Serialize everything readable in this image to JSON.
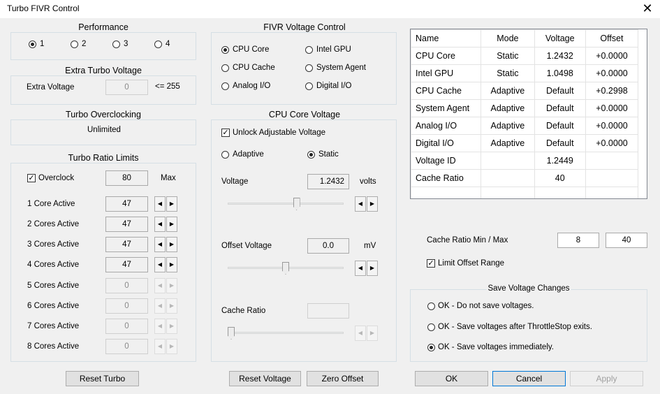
{
  "window": {
    "title": "Turbo FIVR Control",
    "close_glyph": "✕"
  },
  "performance": {
    "title": "Performance",
    "options": [
      {
        "label": "1",
        "selected": true
      },
      {
        "label": "2",
        "selected": false
      },
      {
        "label": "3",
        "selected": false
      },
      {
        "label": "4",
        "selected": false
      }
    ]
  },
  "extra_turbo": {
    "title": "Extra Turbo Voltage",
    "label": "Extra Voltage",
    "value": "0",
    "note": "<= 255"
  },
  "turbo_overclocking": {
    "title": "Turbo Overclocking",
    "status": "Unlimited"
  },
  "turbo_ratio": {
    "title": "Turbo Ratio Limits",
    "overclock_label": "Overclock",
    "overclock_checked": true,
    "overclock_value": "80",
    "max_label": "Max",
    "rows": [
      {
        "label": "1 Core Active",
        "value": "47",
        "enabled": true
      },
      {
        "label": "2 Cores Active",
        "value": "47",
        "enabled": true
      },
      {
        "label": "3 Cores Active",
        "value": "47",
        "enabled": true
      },
      {
        "label": "4 Cores Active",
        "value": "47",
        "enabled": true
      },
      {
        "label": "5 Cores Active",
        "value": "0",
        "enabled": false
      },
      {
        "label": "6 Cores Active",
        "value": "0",
        "enabled": false
      },
      {
        "label": "7 Cores Active",
        "value": "0",
        "enabled": false
      },
      {
        "label": "8 Cores Active",
        "value": "0",
        "enabled": false
      }
    ],
    "reset_button": "Reset Turbo"
  },
  "fivr": {
    "title": "FIVR Voltage Control",
    "options": [
      {
        "label": "CPU Core",
        "selected": true
      },
      {
        "label": "Intel GPU",
        "selected": false
      },
      {
        "label": "CPU Cache",
        "selected": false
      },
      {
        "label": "System Agent",
        "selected": false
      },
      {
        "label": "Analog I/O",
        "selected": false
      },
      {
        "label": "Digital I/O",
        "selected": false
      }
    ]
  },
  "core_voltage": {
    "title": "CPU Core Voltage",
    "unlock_label": "Unlock Adjustable Voltage",
    "unlock_checked": true,
    "mode_adaptive": "Adaptive",
    "mode_static": "Static",
    "mode_selected": "Static",
    "voltage_label": "Voltage",
    "voltage_value": "1.2432",
    "voltage_unit": "volts",
    "offset_label": "Offset Voltage",
    "offset_value": "0.0",
    "offset_unit": "mV",
    "cache_label": "Cache Ratio",
    "cache_value": "",
    "voltage_slider_level": 0.6,
    "offset_slider_level": 0.5,
    "cache_slider_level": 0.0
  },
  "buttons": {
    "reset_voltage": "Reset Voltage",
    "zero_offset": "Zero Offset",
    "ok": "OK",
    "cancel": "Cancel",
    "apply": "Apply"
  },
  "status_table": {
    "headers": [
      "Name",
      "Mode",
      "Voltage",
      "Offset"
    ],
    "rows": [
      [
        "CPU Core",
        "Static",
        "1.2432",
        "+0.0000"
      ],
      [
        "Intel GPU",
        "Static",
        "1.0498",
        "+0.0000"
      ],
      [
        "CPU Cache",
        "Adaptive",
        "Default",
        "+0.2998"
      ],
      [
        "System Agent",
        "Adaptive",
        "Default",
        "+0.0000"
      ],
      [
        "Analog I/O",
        "Adaptive",
        "Default",
        "+0.0000"
      ],
      [
        "Digital I/O",
        "Adaptive",
        "Default",
        "+0.0000"
      ],
      [
        "Voltage ID",
        "",
        "1.2449",
        ""
      ],
      [
        "Cache Ratio",
        "",
        "40",
        ""
      ],
      [
        "",
        "",
        "",
        ""
      ]
    ]
  },
  "cache_ratio_minmax": {
    "label": "Cache Ratio Min / Max",
    "min": "8",
    "max": "40"
  },
  "limit_offset": {
    "label": "Limit Offset Range",
    "checked": true
  },
  "save_changes": {
    "title": "Save Voltage Changes",
    "options": [
      {
        "label": "OK - Do not save voltages.",
        "selected": false
      },
      {
        "label": "OK - Save voltages after ThrottleStop exits.",
        "selected": false
      },
      {
        "label": "OK - Save voltages immediately.",
        "selected": true
      }
    ]
  },
  "icons": {
    "left_arrow": "◀",
    "right_arrow": "▶",
    "check": "✓"
  }
}
